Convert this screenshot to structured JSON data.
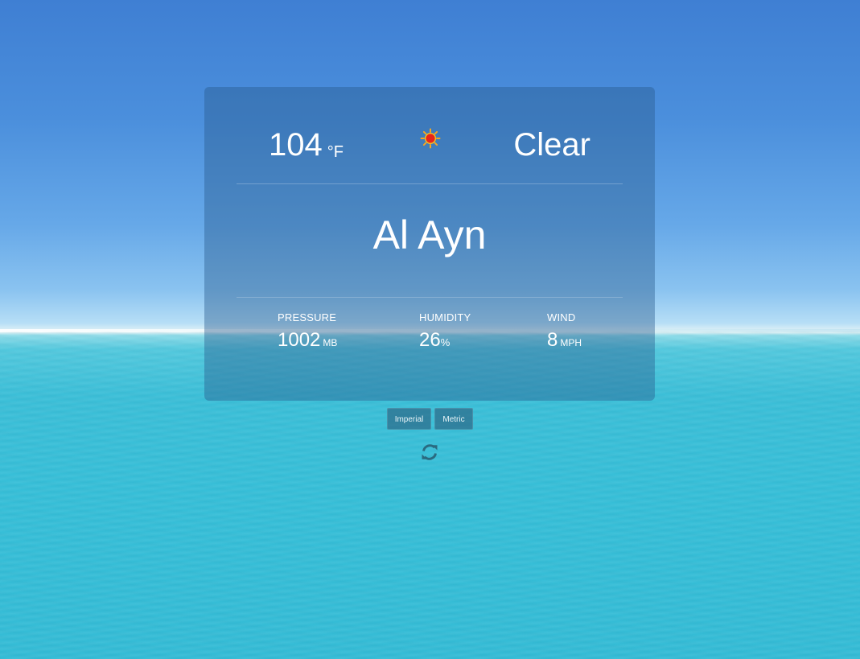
{
  "weather": {
    "temperature": "104",
    "temperature_unit": "°F",
    "icon": "sun-icon",
    "condition": "Clear",
    "city": "Al Ayn"
  },
  "stats": {
    "pressure": {
      "label": "PRESSURE",
      "value": "1002",
      "unit": "MB"
    },
    "humidity": {
      "label": "HUMIDITY",
      "value": "26",
      "unit": "%"
    },
    "wind": {
      "label": "WIND",
      "value": "8",
      "unit": "MPH"
    }
  },
  "controls": {
    "imperial_label": "Imperial",
    "metric_label": "Metric",
    "refresh_icon": "refresh-icon"
  },
  "colors": {
    "card_background": "#285a8c",
    "text": "#ffffff",
    "button_background": "#2d6e8c",
    "refresh_icon": "#2a6a80",
    "sun_core": "#e8241a",
    "sun_rays": "#f5a623"
  }
}
